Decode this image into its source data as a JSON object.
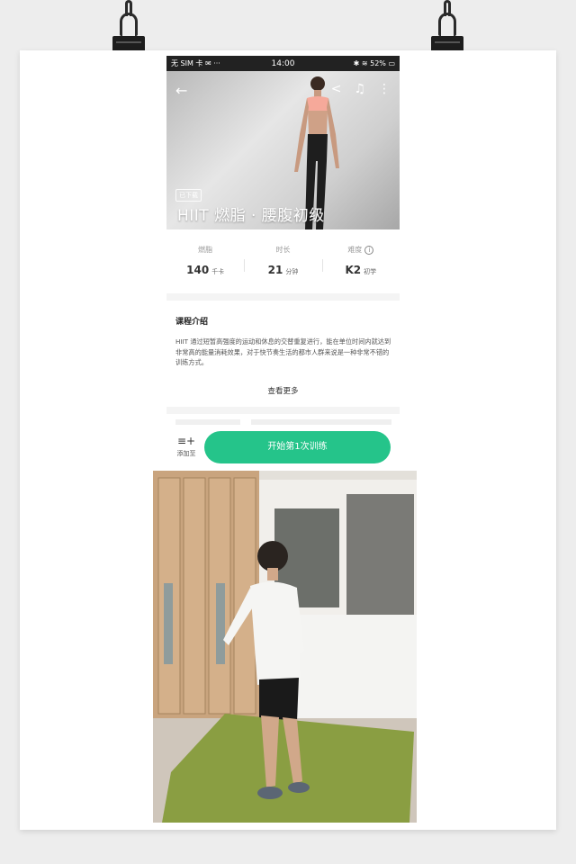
{
  "colors": {
    "accent": "#25c48a",
    "poster_bg": "#ffffff",
    "page_bg": "#ededed"
  },
  "status_bar": {
    "left": "无 SIM 卡 ✉ ···",
    "time": "14:00",
    "right": "✱ ≋ 52% ▭"
  },
  "hero": {
    "back_icon": "arrow-left-icon",
    "share_icon": "share-icon",
    "music_icon": "music-note-icon",
    "more_icon": "more-vertical-icon",
    "badge": "已下载",
    "title": "HIIT 燃脂 · 腰腹初级"
  },
  "stats": [
    {
      "label": "燃脂",
      "value": "140",
      "unit": "千卡"
    },
    {
      "label": "时长",
      "value": "21",
      "unit": "分钟"
    },
    {
      "label": "难度",
      "value": "K2",
      "unit": "初学"
    }
  ],
  "intro": {
    "heading": "课程介绍",
    "body": "HIIT 通过短暂高强度的运动和休息的交替重复进行，能在单位时间内就达到非常高的能量消耗效果，对于快节奏生活的都市人群来说是一种非常不错的训练方式。",
    "more": "查看更多"
  },
  "bottom": {
    "add_label": "添加至",
    "start_label": "开始第1次训练"
  }
}
